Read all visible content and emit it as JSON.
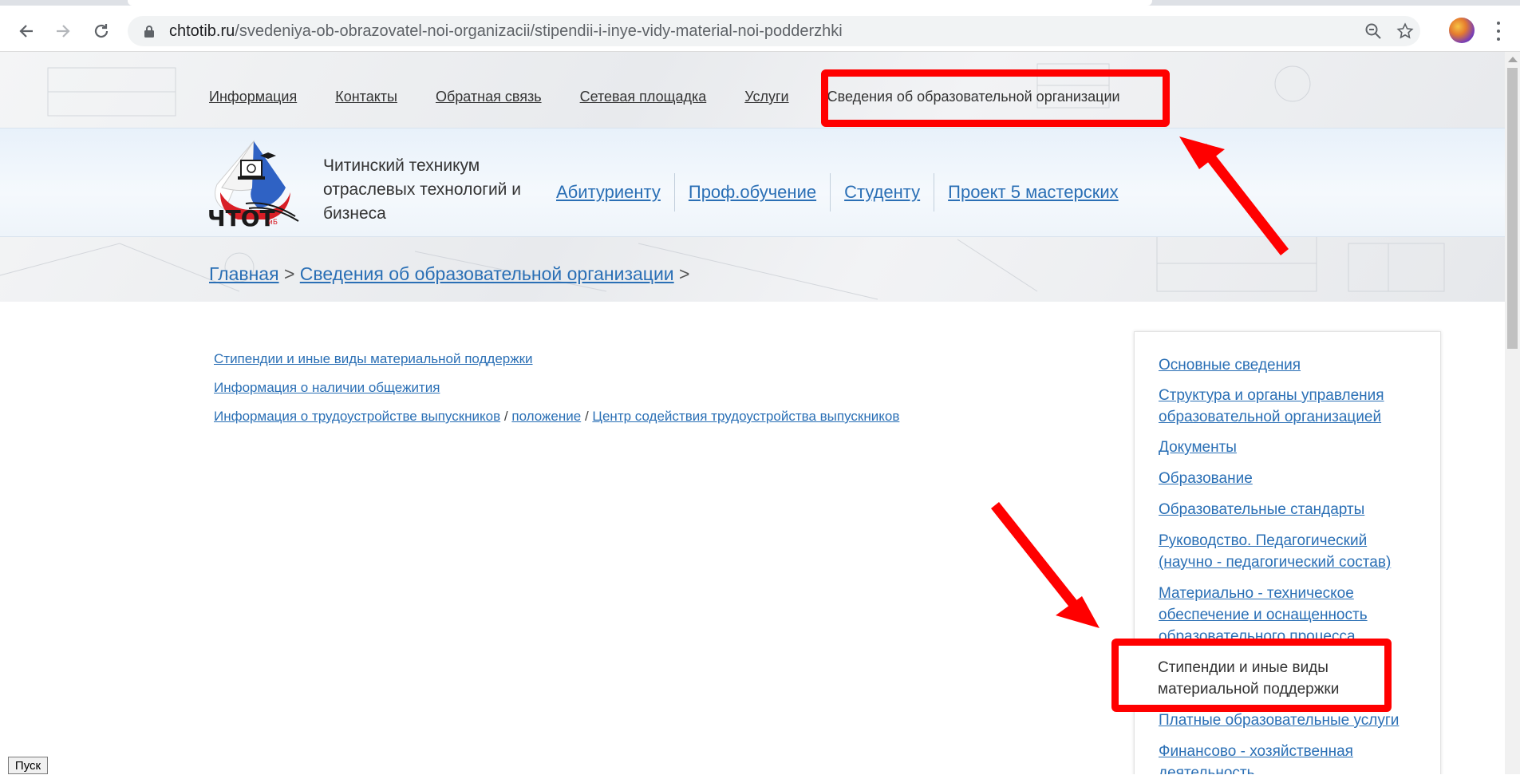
{
  "browser": {
    "url_host": "chtotib.ru",
    "url_path": "/svedeniya-ob-obrazovatel-noi-organizacii/stipendii-i-inye-vidy-material-noi-podderzhki"
  },
  "top_nav": {
    "items": [
      "Информация",
      "Контакты",
      "Обратная связь",
      "Сетевая площадка",
      "Услуги"
    ],
    "active": "Сведения об образовательной организации"
  },
  "org": {
    "name_line1": "Читинский техникум",
    "name_line2": "отраслевых технологий и",
    "name_line3": "бизнеса",
    "logo_text": "ЧТОТ",
    "logo_small": "иБ"
  },
  "main_nav": {
    "items": [
      "Абитуриенту",
      "Проф.обучение",
      "Студенту",
      "Проект 5 мастерских"
    ]
  },
  "breadcrumb": {
    "home": "Главная",
    "sep": ">",
    "section": "Сведения об образовательной организации"
  },
  "content_links": {
    "item1": "Стипендии и иные виды материальной поддержки",
    "item2": "Информация о наличии общежития",
    "item3a": "Информация о трудоустройстве  выпускников",
    "slash": "/",
    "item3b": "положение",
    "item3c": "Центр содействия трудоустройства выпускников"
  },
  "side_menu": {
    "items": [
      "Основные сведения",
      "Структура и органы управления образовательной организацией",
      "Документы",
      "Образование",
      "Образовательные стандарты",
      "Руководство. Педагогический (научно - педагогический состав)",
      "Материально - техническое обеспечение и оснащенность образовательного процесса",
      "Стипендии и иные виды материальной поддержки",
      "Платные образовательные услуги",
      "Финансово - хозяйственная деятельность"
    ]
  },
  "taskbar": {
    "start": "Пуск"
  },
  "colors": {
    "link": "#2a6fb5",
    "highlight": "#ff0000"
  }
}
